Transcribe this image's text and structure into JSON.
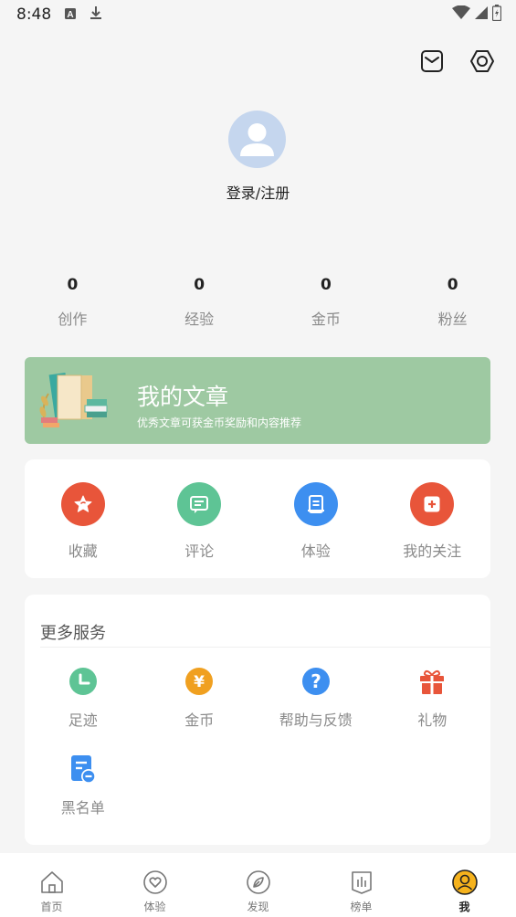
{
  "status_bar": {
    "time": "8:48"
  },
  "header": {
    "mail_icon": "envelope-icon",
    "settings_icon": "hexagon-settings-icon"
  },
  "profile": {
    "login_label": "登录/注册"
  },
  "stats": [
    {
      "value": "0",
      "label": "创作"
    },
    {
      "value": "0",
      "label": "经验"
    },
    {
      "value": "0",
      "label": "金币"
    },
    {
      "value": "0",
      "label": "粉丝"
    }
  ],
  "banner": {
    "title": "我的文章",
    "subtitle": "优秀文章可获金币奖励和内容推荐",
    "color": "#9ec9a2"
  },
  "actions": [
    {
      "label": "收藏",
      "icon": "star-icon",
      "color": "#e8553a"
    },
    {
      "label": "评论",
      "icon": "comment-icon",
      "color": "#5ec495"
    },
    {
      "label": "体验",
      "icon": "document-icon",
      "color": "#3d8ff0"
    },
    {
      "label": "我的关注",
      "icon": "plus-icon",
      "color": "#e8553a"
    }
  ],
  "services": {
    "title": "更多服务",
    "items": [
      {
        "label": "足迹",
        "icon": "clock-icon",
        "color": "#5ec495"
      },
      {
        "label": "金币",
        "icon": "yen-coin-icon",
        "color": "#f0a020"
      },
      {
        "label": "帮助与反馈",
        "icon": "help-icon",
        "color": "#3d8ff0"
      },
      {
        "label": "礼物",
        "icon": "gift-icon",
        "color": "#e8553a"
      },
      {
        "label": "黑名单",
        "icon": "blacklist-icon",
        "color": "#3d8ff0"
      }
    ]
  },
  "bottom_nav": [
    {
      "label": "首页",
      "icon": "home-icon"
    },
    {
      "label": "体验",
      "icon": "heart-icon"
    },
    {
      "label": "发现",
      "icon": "compass-icon"
    },
    {
      "label": "榜单",
      "icon": "ranking-icon"
    },
    {
      "label": "我",
      "icon": "profile-icon",
      "active": true
    }
  ]
}
